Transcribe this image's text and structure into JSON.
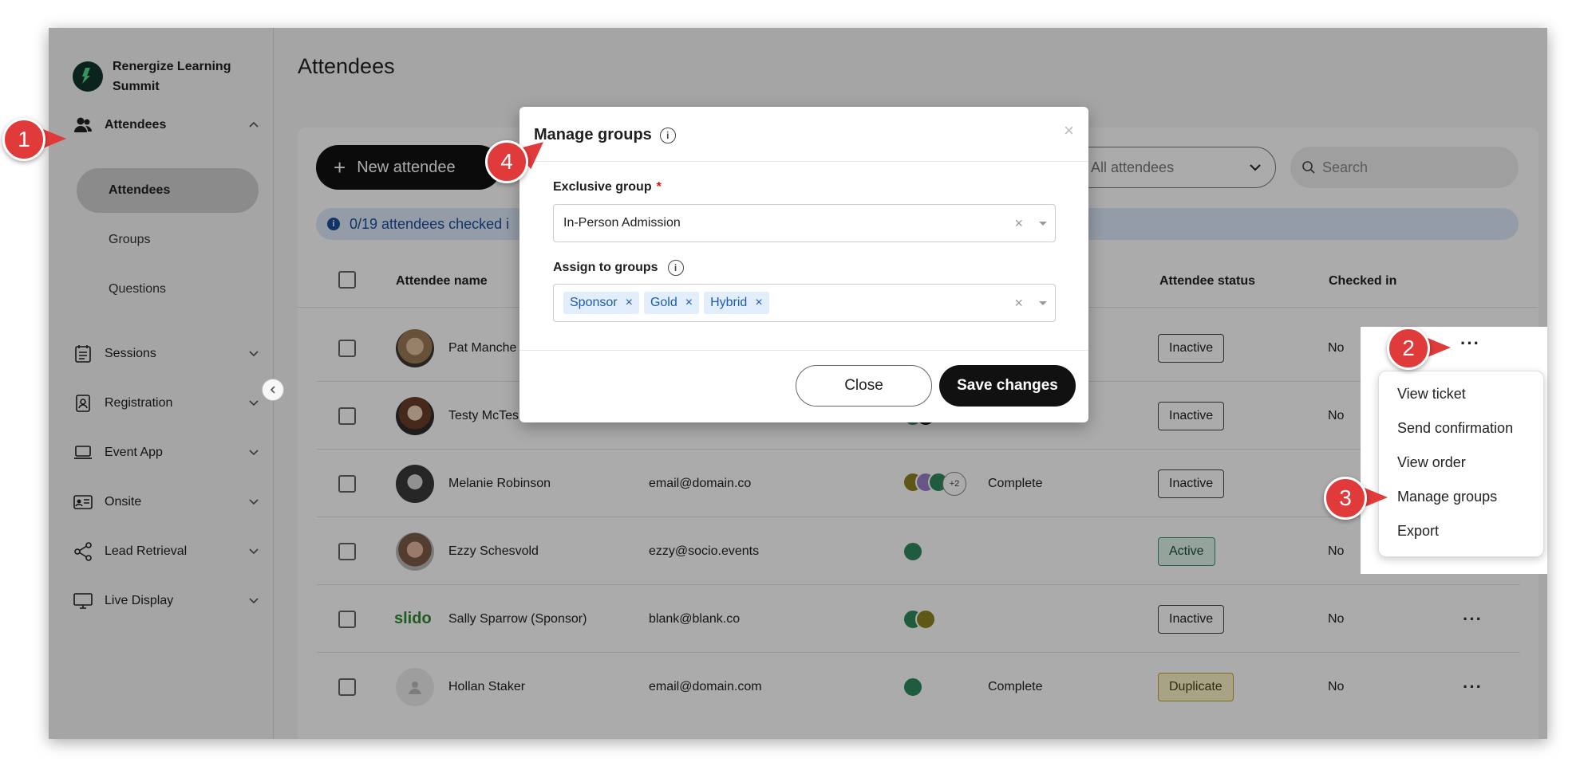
{
  "brand": {
    "name": "Renergize Learning Summit"
  },
  "sidebar": {
    "items": [
      {
        "label": "Attendees"
      },
      {
        "label": "Sessions"
      },
      {
        "label": "Registration"
      },
      {
        "label": "Event App"
      },
      {
        "label": "Onsite"
      },
      {
        "label": "Lead Retrieval"
      },
      {
        "label": "Live Display"
      }
    ],
    "sub_items": [
      {
        "label": "Attendees",
        "active": true
      },
      {
        "label": "Groups"
      },
      {
        "label": "Questions"
      }
    ]
  },
  "page": {
    "title": "Attendees"
  },
  "toolbar": {
    "new_attendee_label": "New attendee",
    "filter_value": "All attendees",
    "search_placeholder": "Search"
  },
  "banner": {
    "text": "0/19 attendees checked i"
  },
  "table": {
    "columns": [
      "Attendee name",
      "Attendee status",
      "Checked in"
    ],
    "rows": [
      {
        "name": "Pat Manche",
        "email": "",
        "status_text": "",
        "badge": "Inactive",
        "checked": "No"
      },
      {
        "name": "Testy McTes",
        "email": "",
        "status_text": "",
        "badge": "Inactive",
        "checked": "No"
      },
      {
        "name": "Melanie Robinson",
        "email": "email@domain.co",
        "status_text": "Complete",
        "badge": "Inactive",
        "checked": "",
        "extra_groups": "+2"
      },
      {
        "name": "Ezzy Schesvold",
        "email": "ezzy@socio.events",
        "status_text": "",
        "badge": "Active",
        "checked": "No"
      },
      {
        "name": "Sally Sparrow (Sponsor)",
        "email": "blank@blank.co",
        "status_text": "",
        "badge": "Inactive",
        "checked": "No",
        "logo_text": "slido"
      },
      {
        "name": "Hollan Staker",
        "email": "email@domain.com",
        "status_text": "Complete",
        "badge": "Duplicate",
        "checked": "No"
      }
    ]
  },
  "context_menu": {
    "items": [
      "View ticket",
      "Send confirmation",
      "View order",
      "Manage groups",
      "Export"
    ]
  },
  "modal": {
    "title": "Manage groups",
    "exclusive_label": "Exclusive group",
    "exclusive_value": "In-Person Admission",
    "assign_label": "Assign to groups",
    "tags": [
      "Sponsor",
      "Gold",
      "Hybrid"
    ],
    "close_label": "Close",
    "save_label": "Save changes"
  },
  "callouts": [
    "1",
    "2",
    "3",
    "4"
  ],
  "colors": {
    "callout": "#e03a3a",
    "group_green": "#2f8a5c",
    "group_olive": "#8d8221",
    "group_purple": "#9b7fc9",
    "banner_blue": "#1b4d9c"
  }
}
